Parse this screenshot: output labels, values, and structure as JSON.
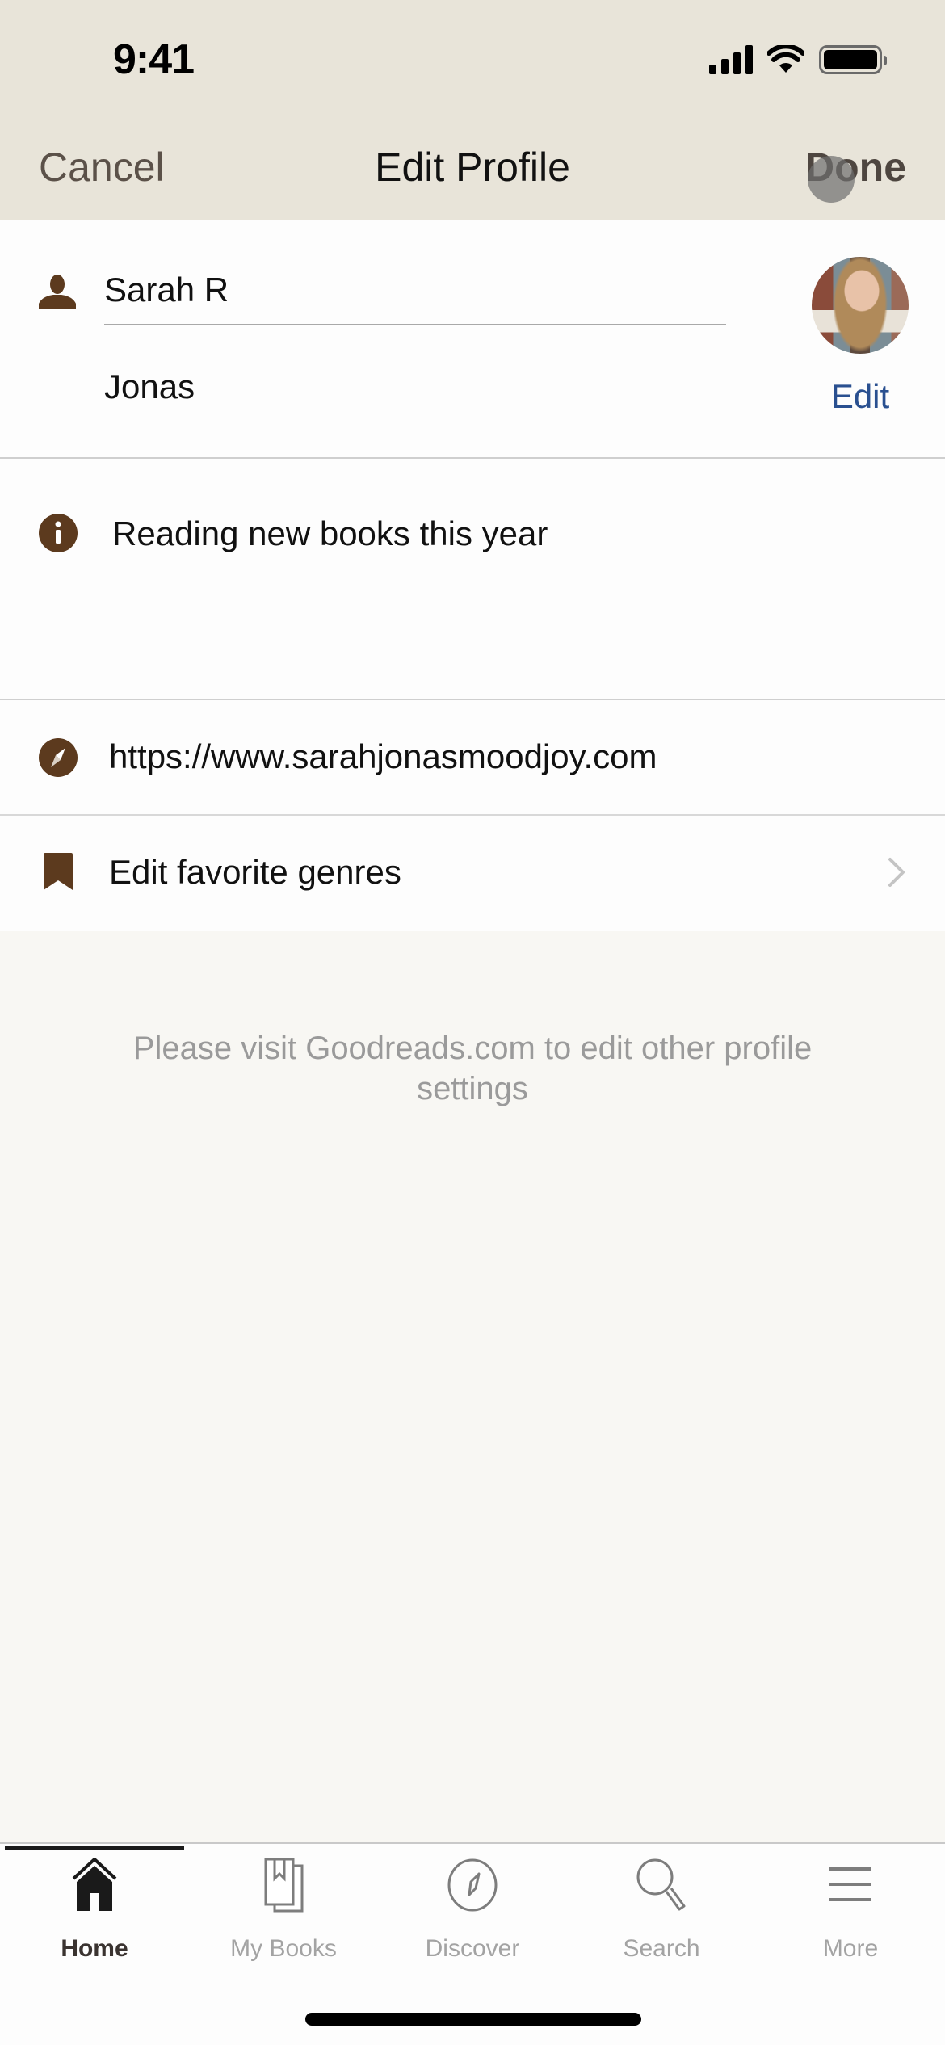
{
  "status_bar": {
    "time": "9:41",
    "icons": [
      "cellular-signal-icon",
      "wifi-icon",
      "battery-icon"
    ]
  },
  "nav": {
    "cancel_label": "Cancel",
    "title": "Edit Profile",
    "done_label": "Done"
  },
  "profile": {
    "first_name": "Sarah R",
    "last_name": "Jonas",
    "avatar_edit_label": "Edit",
    "bio": "Reading new books this year",
    "website": "https://www.sarahjonasmoodjoy.com",
    "genres_label": "Edit favorite genres"
  },
  "footer_note": "Please visit Goodreads.com to edit other profile settings",
  "tabbar": {
    "active": "Home",
    "tabs": [
      {
        "label": "Home",
        "icon": "home-icon"
      },
      {
        "label": "My Books",
        "icon": "books-icon"
      },
      {
        "label": "Discover",
        "icon": "compass-icon"
      },
      {
        "label": "Search",
        "icon": "search-icon"
      },
      {
        "label": "More",
        "icon": "menu-icon"
      }
    ]
  },
  "colors": {
    "header_bg": "#e8e4d9",
    "icon_brown": "#5c3a1e",
    "link_blue": "#2a5090",
    "page_bg": "#f8f7f3"
  }
}
